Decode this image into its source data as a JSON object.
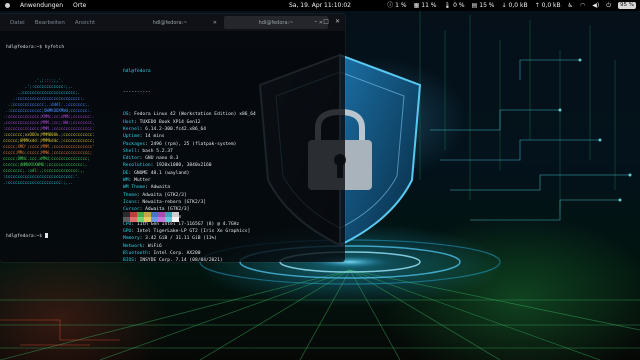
{
  "topbar": {
    "apps_label": "Anwendungen",
    "places_label": "Orte",
    "clock": "Sa, 19. Apr 11:10:02",
    "tray": {
      "notif_count": "1 %",
      "cpu": "11 %",
      "temp": "0 %",
      "mem": "15 %",
      "net_down": "0,0 kB",
      "net_up": "0,0 kB",
      "battery": "95 %"
    }
  },
  "terminal": {
    "menu": [
      "Datei",
      "Bearbeiten",
      "Ansicht"
    ],
    "tabs": [
      {
        "label": "hdl@fedora:~"
      },
      {
        "label": "hdl@fedora:~"
      }
    ],
    "left_pane": {
      "command_line": "hdl@fedora:~$ hyfetch",
      "bottom_prompt": "hdl@fedora:~$",
      "logo_lines": [
        "             .',;::::;,'.",
        "         .';:cccccccccccc:;,.",
        "      .;cccccccccccccccccccccc;.",
        "    .:cccccccccccccccccccccccccc:.",
        "  .;ccccccccccccc;.:dddl:.;ccccccc;.",
        " .:ccccccccccccc;OWMKOOXMWd;ccccccc:.",
        ".:ccccccccccccc;KMMc;cc;xMMc;ccccccc:.",
        ",cccccccccccccc;MMM.;cc;;WW:;cccccccc,",
        ":cccccccccccccc;MMM.;cccccccccccccccc:",
        ":ccccccc;oxOOOo;MMM000k.;cccccccccccc:",
        "cccccc;0MMKxdd:;MMMkddc.;cccccccccccc;",
        "ccccc;XMO';cccc;MMM.;cccccccccccccccc'",
        "ccccc;MMo;ccccc;MMW.;ccccccccccccccc;",
        "ccccc;0MNc.ccc.xMMd;ccccccccccccccc;",
        "cccccc;dNMWXXXWM0:;cccccccccccccc:,",
        "cccccccc;.:odl:.;cccccccccccccc:,.",
        ":cccccccccccccccccccccccccccc:'.",
        ".:cccccccccccccccccccccc:;,.."
      ]
    },
    "right_pane": {
      "user_host": "hdl@fedora",
      "separator": "----------",
      "info": [
        {
          "key": "OS",
          "value": "Fedora Linux 42 (Workstation Edition) x86_64"
        },
        {
          "key": "Host",
          "value": "TUXEDO Book XP14 Gen12"
        },
        {
          "key": "Kernel",
          "value": "6.14.2-300.fc42.x86_64"
        },
        {
          "key": "Uptime",
          "value": "14 mins"
        },
        {
          "key": "Packages",
          "value": "2496 (rpm), 25 (flatpak-system)"
        },
        {
          "key": "Shell",
          "value": "bash 5.2.37"
        },
        {
          "key": "Editor",
          "value": "GNU nano 8.3"
        },
        {
          "key": "Resolution",
          "value": "1920x1080, 3840x2160"
        },
        {
          "key": "DE",
          "value": "GNOME 48.1 (wayland)"
        },
        {
          "key": "WM",
          "value": "Mutter"
        },
        {
          "key": "WM Theme",
          "value": "Adwaita"
        },
        {
          "key": "Theme",
          "value": "Adwaita [GTK2/3]"
        },
        {
          "key": "Icons",
          "value": "Newaita-reborn [GTK2/3]"
        },
        {
          "key": "Cursor",
          "value": "Adwaita [GTK2/3]"
        },
        {
          "key": "Terminal",
          "value": "cosmic-term"
        },
        {
          "key": "CPU",
          "value": "11th Gen Intel i7-1165G7 (8) @ 4.7GHz"
        },
        {
          "key": "GPU",
          "value": "Intel TigerLake-LP GT2 [Iris Xe Graphics]"
        },
        {
          "key": "Memory",
          "value": "3.42 GiB / 31.11 GiB (11%)"
        },
        {
          "key": "Network",
          "value": "WiFi6"
        },
        {
          "key": "Bluetooth",
          "value": "Intel Corp. AX200"
        },
        {
          "key": "BIOS",
          "value": "INSYDE Corp. 7.14 (08/04/2021)"
        }
      ],
      "palette_top": [
        "#2b2b2b",
        "#c23b3b",
        "#4ea94e",
        "#c8a740",
        "#4a74c7",
        "#a24fb0",
        "#3aa8b6",
        "#cfcfcf"
      ],
      "palette_bottom": [
        "#5a5a5a",
        "#e06a6a",
        "#74d174",
        "#e8cc62",
        "#6e96e6",
        "#c676d6",
        "#5fcad8",
        "#f4f4f4"
      ]
    }
  },
  "colors": {
    "accent_cyan": "#2fd0e3",
    "shield_glow": "#3fb8e8",
    "circuit_green": "#3fd152"
  }
}
